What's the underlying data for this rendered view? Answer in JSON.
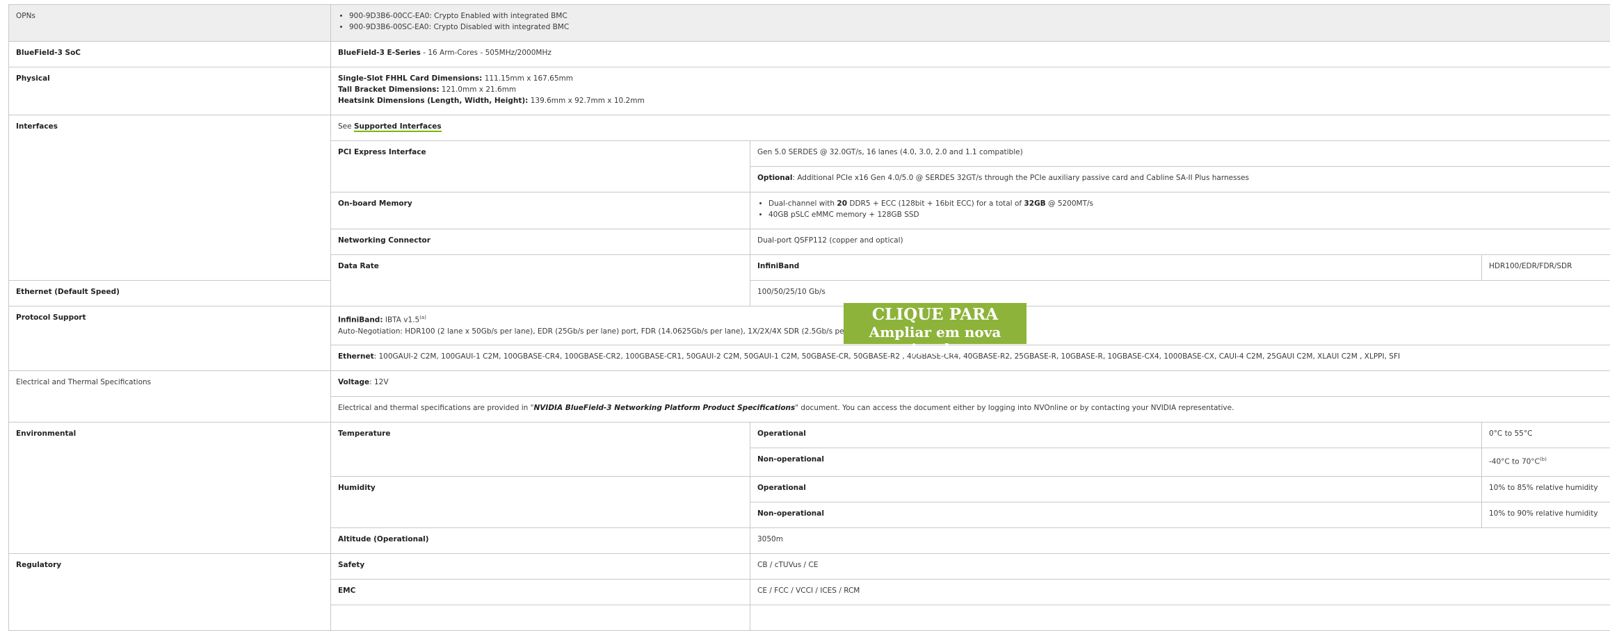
{
  "rows": {
    "opns": {
      "label": "OPNs",
      "items": [
        "900-9D3B6-00CC-EA0: Crypto Enabled with integrated BMC",
        "900-9D3B6-00SC-EA0: Crypto Disabled with integrated BMC"
      ]
    },
    "soc": {
      "label": "BlueField-3 SoC",
      "bold": "BlueField-3 E-Series",
      "rest": " - 16 Arm-Cores - 505MHz/2000MHz"
    },
    "physical": {
      "label": "Physical",
      "l1b": "Single-Slot FHHL Card Dimensions:",
      "l1": " 111.15mm x 167.65mm",
      "l2b": "Tall Bracket Dimensions:",
      "l2": " 121.0mm x 21.6mm",
      "l3b": "Heatsink Dimensions (Length, Width, Height):",
      "l3": " 139.6mm x 92.7mm x 10.2mm"
    },
    "interfaces": {
      "label": "Interfaces",
      "see": "See ",
      "link": "Supported Interfaces",
      "pcie_label": "PCI Express Interface",
      "pcie_value": "Gen 5.0 SERDES @ 32.0GT/s, 16 lanes (4.0, 3.0, 2.0 and 1.1 compatible)",
      "optional_b": "Optional",
      "optional": ": Additional PCIe x16 Gen 4.0/5.0 @ SERDES 32GT/s through the PCIe auxiliary passive card and Cabline SA-II Plus harnesses",
      "mem_label": "On-board Memory",
      "mem1_a": "Dual-channel with ",
      "mem1_b1": "20",
      "mem1_c": " DDR5 + ECC (128bit + 16bit ECC) for a total of ",
      "mem1_b2": "32GB",
      "mem1_d": " @ 5200MT/s",
      "mem2": "40GB pSLC eMMC memory + 128GB SSD",
      "net_label": "Networking Connector",
      "net_value": "Dual-port QSFP112 (copper and optical)"
    },
    "datarate": {
      "label": "Data Rate",
      "ib_label": "InfiniBand",
      "ib_value": "HDR100/EDR/FDR/SDR",
      "eth_label": "Ethernet (Default Speed)",
      "eth_value": "100/50/25/10 Gb/s"
    },
    "protocol": {
      "label": "Protocol Support",
      "ib_b": "InfiniBand:",
      "ib": " IBTA v1.5",
      "ib_sup": "(a)",
      "ib_line2": "Auto-Negotiation: HDR100 (2 lane x 50Gb/s per lane), EDR (25Gb/s per lane) port, FDR (14.0625Gb/s per lane), 1X/2X/4X SDR (2.5Gb/s per lane).",
      "eth_b": "Ethernet",
      "eth": ": 100GAUI-2 C2M, 100GAUI-1 C2M, 100GBASE-CR4, 100GBASE-CR2, 100GBASE-CR1, 50GAUI-2 C2M, 50GAUI-1 C2M, 50GBASE-CR, 50GBASE-R2 , 40GBASE-CR4, 40GBASE-R2, 25GBASE-R, 10GBASE-R, 10GBASE-CX4, 1000BASE-CX, CAUI-4 C2M, 25GAUI C2M, XLAUI C2M , XLPPI, SFI"
    },
    "electrical": {
      "label": "Electrical and Thermal Specifications",
      "volt_b": "Voltage",
      "volt": ": 12V",
      "note_a": "Electrical and thermal specifications are provided in \"",
      "note_b": "NVIDIA BlueField-3 Networking Platform Product Specifications",
      "note_c": "\" document. You can access the document either by logging into NVOnline or by contacting your NVIDIA representative."
    },
    "environmental": {
      "label": "Environmental",
      "temp_label": "Temperature",
      "op": "Operational",
      "nonop": "Non-operational",
      "temp_op": "0°C to 55°C",
      "temp_nonop": "-40°C to 70°C",
      "temp_sup": "(b)",
      "hum_label": "Humidity",
      "hum_op": "10% to 85% relative humidity",
      "hum_nonop": "10% to 90% relative humidity",
      "alt_label": "Altitude (Operational)",
      "alt_value": "3050m"
    },
    "regulatory": {
      "label": "Regulatory",
      "safety_label": "Safety",
      "safety_value": "CB / cTUVus / CE",
      "emc_label": "EMC",
      "emc_value": "CE / FCC / VCCI / ICES / RCM"
    }
  },
  "overlay": {
    "line1": "CLIQUE PARA",
    "line2": "Ampliar em nova janela"
  }
}
